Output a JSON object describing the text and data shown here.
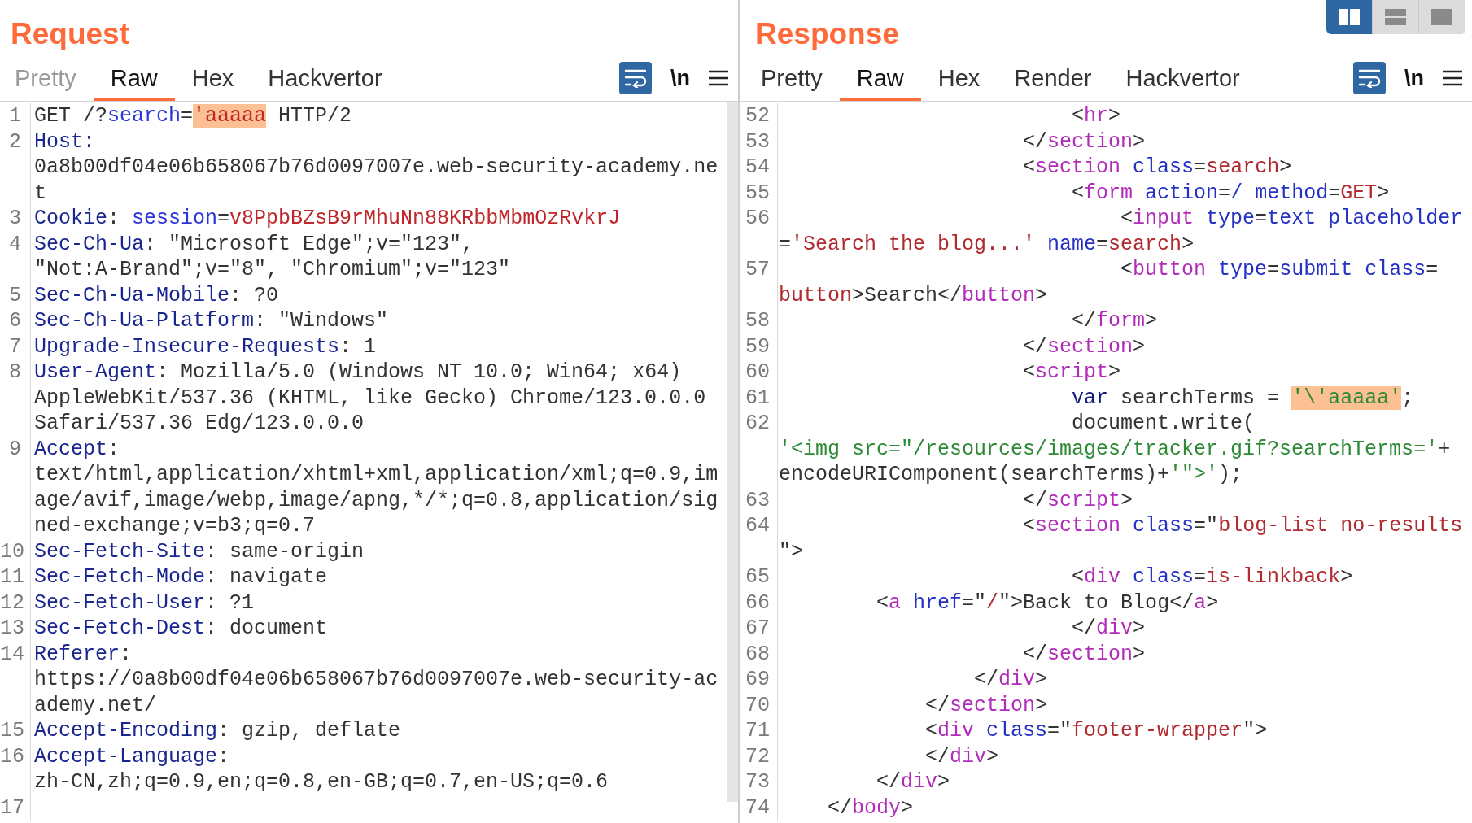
{
  "request": {
    "title": "Request",
    "tabs": [
      {
        "label": "Pretty",
        "selected": false,
        "disabled": true
      },
      {
        "label": "Raw",
        "selected": true,
        "disabled": false
      },
      {
        "label": "Hex",
        "selected": false,
        "disabled": false
      },
      {
        "label": "Hackvertor",
        "selected": false,
        "disabled": false
      }
    ],
    "toolbar": {
      "wrap": {
        "on": true
      },
      "newline": {
        "label": "\\n",
        "on": false
      }
    },
    "lines": [
      {
        "number": "1",
        "rows": [
          {
            "segments": [
              {
                "kind": "plain",
                "text": "GET /?"
              },
              {
                "kind": "param",
                "text": "search"
              },
              {
                "kind": "plain",
                "text": "="
              },
              {
                "kind": "marked-value",
                "text": "'aaaaa"
              },
              {
                "kind": "plain",
                "text": " HTTP/2"
              }
            ]
          }
        ]
      },
      {
        "number": "2",
        "rows": [
          {
            "segments": [
              {
                "kind": "header",
                "text": "Host:"
              }
            ]
          },
          {
            "segments": [
              {
                "kind": "plain",
                "text": "0a8b00df04e06b658067b76d0097007e.web-security-academy.ne"
              }
            ]
          },
          {
            "segments": [
              {
                "kind": "plain",
                "text": "t"
              }
            ]
          }
        ]
      },
      {
        "number": "3",
        "rows": [
          {
            "segments": [
              {
                "kind": "header",
                "text": "Cookie"
              },
              {
                "kind": "plain",
                "text": ": "
              },
              {
                "kind": "param",
                "text": "session"
              },
              {
                "kind": "plain",
                "text": "="
              },
              {
                "kind": "value",
                "text": "v8PpbBZsB9rMhuNn88KRbbMbmOzRvkrJ"
              }
            ]
          }
        ]
      },
      {
        "number": "4",
        "rows": [
          {
            "segments": [
              {
                "kind": "header",
                "text": "Sec-Ch-Ua"
              },
              {
                "kind": "plain",
                "text": ": \"Microsoft Edge\";v=\"123\","
              }
            ]
          },
          {
            "segments": [
              {
                "kind": "plain",
                "text": "\"Not:A-Brand\";v=\"8\", \"Chromium\";v=\"123\""
              }
            ]
          }
        ]
      },
      {
        "number": "5",
        "rows": [
          {
            "segments": [
              {
                "kind": "header",
                "text": "Sec-Ch-Ua-Mobile"
              },
              {
                "kind": "plain",
                "text": ": ?0"
              }
            ]
          }
        ]
      },
      {
        "number": "6",
        "rows": [
          {
            "segments": [
              {
                "kind": "header",
                "text": "Sec-Ch-Ua-Platform"
              },
              {
                "kind": "plain",
                "text": ": \"Windows\""
              }
            ]
          }
        ]
      },
      {
        "number": "7",
        "rows": [
          {
            "segments": [
              {
                "kind": "header",
                "text": "Upgrade-Insecure-Requests"
              },
              {
                "kind": "plain",
                "text": ": 1"
              }
            ]
          }
        ]
      },
      {
        "number": "8",
        "rows": [
          {
            "segments": [
              {
                "kind": "header",
                "text": "User-Agent"
              },
              {
                "kind": "plain",
                "text": ": Mozilla/5.0 (Windows NT 10.0; Win64; x64)"
              }
            ]
          },
          {
            "segments": [
              {
                "kind": "plain",
                "text": "AppleWebKit/537.36 (KHTML, like Gecko) Chrome/123.0.0.0"
              }
            ]
          },
          {
            "segments": [
              {
                "kind": "plain",
                "text": "Safari/537.36 Edg/123.0.0.0"
              }
            ]
          }
        ]
      },
      {
        "number": "9",
        "rows": [
          {
            "segments": [
              {
                "kind": "header",
                "text": "Accept"
              },
              {
                "kind": "plain",
                "text": ":"
              }
            ]
          },
          {
            "segments": [
              {
                "kind": "plain",
                "text": "text/html,application/xhtml+xml,application/xml;q=0.9,im"
              }
            ]
          },
          {
            "segments": [
              {
                "kind": "plain",
                "text": "age/avif,image/webp,image/apng,*/*;q=0.8,application/sig"
              }
            ]
          },
          {
            "segments": [
              {
                "kind": "plain",
                "text": "ned-exchange;v=b3;q=0.7"
              }
            ]
          }
        ]
      },
      {
        "number": "10",
        "rows": [
          {
            "segments": [
              {
                "kind": "header",
                "text": "Sec-Fetch-Site"
              },
              {
                "kind": "plain",
                "text": ": same-origin"
              }
            ]
          }
        ]
      },
      {
        "number": "11",
        "rows": [
          {
            "segments": [
              {
                "kind": "header",
                "text": "Sec-Fetch-Mode"
              },
              {
                "kind": "plain",
                "text": ": navigate"
              }
            ]
          }
        ]
      },
      {
        "number": "12",
        "rows": [
          {
            "segments": [
              {
                "kind": "header",
                "text": "Sec-Fetch-User"
              },
              {
                "kind": "plain",
                "text": ": ?1"
              }
            ]
          }
        ]
      },
      {
        "number": "13",
        "rows": [
          {
            "segments": [
              {
                "kind": "header",
                "text": "Sec-Fetch-Dest"
              },
              {
                "kind": "plain",
                "text": ": document"
              }
            ]
          }
        ]
      },
      {
        "number": "14",
        "rows": [
          {
            "segments": [
              {
                "kind": "header",
                "text": "Referer"
              },
              {
                "kind": "plain",
                "text": ":"
              }
            ]
          },
          {
            "segments": [
              {
                "kind": "plain",
                "text": "https://0a8b00df04e06b658067b76d0097007e.web-security-ac"
              }
            ]
          },
          {
            "segments": [
              {
                "kind": "plain",
                "text": "ademy.net/"
              }
            ]
          }
        ]
      },
      {
        "number": "15",
        "rows": [
          {
            "segments": [
              {
                "kind": "header",
                "text": "Accept-Encoding"
              },
              {
                "kind": "plain",
                "text": ": gzip, deflate"
              }
            ]
          }
        ]
      },
      {
        "number": "16",
        "rows": [
          {
            "segments": [
              {
                "kind": "header",
                "text": "Accept-Language"
              },
              {
                "kind": "plain",
                "text": ":"
              }
            ]
          },
          {
            "segments": [
              {
                "kind": "plain",
                "text": "zh-CN,zh;q=0.9,en;q=0.8,en-GB;q=0.7,en-US;q=0.6"
              }
            ]
          }
        ]
      },
      {
        "number": "17"
      }
    ]
  },
  "response": {
    "title": "Response",
    "layout_toggle": [
      {
        "kind": "columns",
        "selected": true
      },
      {
        "kind": "rows",
        "selected": false
      },
      {
        "kind": "single",
        "selected": false
      }
    ],
    "tabs": [
      {
        "label": "Pretty",
        "selected": false,
        "disabled": false
      },
      {
        "label": "Raw",
        "selected": true,
        "disabled": false
      },
      {
        "label": "Hex",
        "selected": false,
        "disabled": false
      },
      {
        "label": "Render",
        "selected": false,
        "disabled": false
      },
      {
        "label": "Hackvertor",
        "selected": false,
        "disabled": false
      }
    ],
    "toolbar": {
      "wrap": {
        "on": true
      },
      "newline": {
        "label": "\\n",
        "on": false
      }
    },
    "lines": [
      {
        "number": "52",
        "rows": [
          {
            "segments": [
              {
                "kind": "plain",
                "text": "                        <"
              },
              {
                "kind": "tag",
                "text": "hr"
              },
              {
                "kind": "plain",
                "text": ">"
              }
            ]
          }
        ]
      },
      {
        "number": "53",
        "rows": [
          {
            "segments": [
              {
                "kind": "plain",
                "text": "                    </"
              },
              {
                "kind": "tag",
                "text": "section"
              },
              {
                "kind": "plain",
                "text": ">"
              }
            ]
          }
        ]
      },
      {
        "number": "54",
        "rows": [
          {
            "segments": [
              {
                "kind": "plain",
                "text": "                    <"
              },
              {
                "kind": "tag",
                "text": "section"
              },
              {
                "kind": "attr",
                "text": " class"
              },
              {
                "kind": "plain",
                "text": "="
              },
              {
                "kind": "attrval",
                "text": "search"
              },
              {
                "kind": "plain",
                "text": ">"
              }
            ]
          }
        ]
      },
      {
        "number": "55",
        "rows": [
          {
            "segments": [
              {
                "kind": "plain",
                "text": "                        <"
              },
              {
                "kind": "tag",
                "text": "form"
              },
              {
                "kind": "attr",
                "text": " action"
              },
              {
                "kind": "plain",
                "text": "="
              },
              {
                "kind": "attr",
                "text": "/ method"
              },
              {
                "kind": "plain",
                "text": "="
              },
              {
                "kind": "attrval",
                "text": "GET"
              },
              {
                "kind": "plain",
                "text": ">"
              }
            ]
          }
        ]
      },
      {
        "number": "56",
        "rows": [
          {
            "segments": [
              {
                "kind": "plain",
                "text": "                            <"
              },
              {
                "kind": "tag",
                "text": "input"
              },
              {
                "kind": "attr",
                "text": " type"
              },
              {
                "kind": "plain",
                "text": "="
              },
              {
                "kind": "attr",
                "text": "text placeholder"
              }
            ]
          },
          {
            "segments": [
              {
                "kind": "plain",
                "text": "="
              },
              {
                "kind": "attrval",
                "text": "'Search the blog...'"
              },
              {
                "kind": "attr",
                "text": " name"
              },
              {
                "kind": "plain",
                "text": "="
              },
              {
                "kind": "attrval",
                "text": "search"
              },
              {
                "kind": "plain",
                "text": ">"
              }
            ]
          }
        ]
      },
      {
        "number": "57",
        "rows": [
          {
            "segments": [
              {
                "kind": "plain",
                "text": "                            <"
              },
              {
                "kind": "tag",
                "text": "button"
              },
              {
                "kind": "attr",
                "text": " type"
              },
              {
                "kind": "plain",
                "text": "="
              },
              {
                "kind": "attr",
                "text": "submit class"
              },
              {
                "kind": "plain",
                "text": "="
              }
            ]
          },
          {
            "segments": [
              {
                "kind": "attrval",
                "text": "button"
              },
              {
                "kind": "plain",
                "text": ">Search</"
              },
              {
                "kind": "tag",
                "text": "button"
              },
              {
                "kind": "plain",
                "text": ">"
              }
            ]
          }
        ]
      },
      {
        "number": "58",
        "rows": [
          {
            "segments": [
              {
                "kind": "plain",
                "text": "                        </"
              },
              {
                "kind": "tag",
                "text": "form"
              },
              {
                "kind": "plain",
                "text": ">"
              }
            ]
          }
        ]
      },
      {
        "number": "59",
        "rows": [
          {
            "segments": [
              {
                "kind": "plain",
                "text": "                    </"
              },
              {
                "kind": "tag",
                "text": "section"
              },
              {
                "kind": "plain",
                "text": ">"
              }
            ]
          }
        ]
      },
      {
        "number": "60",
        "rows": [
          {
            "segments": [
              {
                "kind": "plain",
                "text": "                    <"
              },
              {
                "kind": "tag",
                "text": "script"
              },
              {
                "kind": "plain",
                "text": ">"
              }
            ]
          }
        ]
      },
      {
        "number": "61",
        "rows": [
          {
            "segments": [
              {
                "kind": "keyword",
                "text": "                        var"
              },
              {
                "kind": "plain",
                "text": " searchTerms = "
              },
              {
                "kind": "marked-string",
                "text": "'\\'aaaaa'"
              },
              {
                "kind": "plain",
                "text": ";"
              }
            ]
          }
        ]
      },
      {
        "number": "62",
        "rows": [
          {
            "segments": [
              {
                "kind": "plain",
                "text": "                        document.write("
              }
            ]
          },
          {
            "segments": [
              {
                "kind": "string",
                "text": "'<img src=\"/resources/images/tracker.gif?searchTerms='"
              },
              {
                "kind": "plain",
                "text": "+"
              }
            ]
          },
          {
            "segments": [
              {
                "kind": "plain",
                "text": "encodeURIComponent(searchTerms)+"
              },
              {
                "kind": "string",
                "text": "'\">'"
              },
              {
                "kind": "plain",
                "text": ");"
              }
            ]
          }
        ]
      },
      {
        "number": "63",
        "rows": [
          {
            "segments": [
              {
                "kind": "plain",
                "text": "                    </"
              },
              {
                "kind": "tag",
                "text": "script"
              },
              {
                "kind": "plain",
                "text": ">"
              }
            ]
          }
        ]
      },
      {
        "number": "64",
        "rows": [
          {
            "segments": [
              {
                "kind": "plain",
                "text": "                    <"
              },
              {
                "kind": "tag",
                "text": "section"
              },
              {
                "kind": "attr",
                "text": " class"
              },
              {
                "kind": "plain",
                "text": "=\""
              },
              {
                "kind": "attrval",
                "text": "blog-list no-results"
              }
            ]
          },
          {
            "segments": [
              {
                "kind": "plain",
                "text": "\">"
              }
            ]
          }
        ]
      },
      {
        "number": "65",
        "rows": [
          {
            "segments": [
              {
                "kind": "plain",
                "text": "                        <"
              },
              {
                "kind": "tag",
                "text": "div"
              },
              {
                "kind": "attr",
                "text": " class"
              },
              {
                "kind": "plain",
                "text": "="
              },
              {
                "kind": "attrval",
                "text": "is-linkback"
              },
              {
                "kind": "plain",
                "text": ">"
              }
            ]
          }
        ]
      },
      {
        "number": "66",
        "rows": [
          {
            "segments": [
              {
                "kind": "plain",
                "text": "        <"
              },
              {
                "kind": "tag",
                "text": "a"
              },
              {
                "kind": "attr",
                "text": " href"
              },
              {
                "kind": "plain",
                "text": "=\""
              },
              {
                "kind": "attrval",
                "text": "/"
              },
              {
                "kind": "plain",
                "text": "\">Back to Blog</"
              },
              {
                "kind": "tag",
                "text": "a"
              },
              {
                "kind": "plain",
                "text": ">"
              }
            ]
          }
        ]
      },
      {
        "number": "67",
        "rows": [
          {
            "segments": [
              {
                "kind": "plain",
                "text": "                        </"
              },
              {
                "kind": "tag",
                "text": "div"
              },
              {
                "kind": "plain",
                "text": ">"
              }
            ]
          }
        ]
      },
      {
        "number": "68",
        "rows": [
          {
            "segments": [
              {
                "kind": "plain",
                "text": "                    </"
              },
              {
                "kind": "tag",
                "text": "section"
              },
              {
                "kind": "plain",
                "text": ">"
              }
            ]
          }
        ]
      },
      {
        "number": "69",
        "rows": [
          {
            "segments": [
              {
                "kind": "plain",
                "text": "                </"
              },
              {
                "kind": "tag",
                "text": "div"
              },
              {
                "kind": "plain",
                "text": ">"
              }
            ]
          }
        ]
      },
      {
        "number": "70",
        "rows": [
          {
            "segments": [
              {
                "kind": "plain",
                "text": "            </"
              },
              {
                "kind": "tag",
                "text": "section"
              },
              {
                "kind": "plain",
                "text": ">"
              }
            ]
          }
        ]
      },
      {
        "number": "71",
        "rows": [
          {
            "segments": [
              {
                "kind": "plain",
                "text": "            <"
              },
              {
                "kind": "tag",
                "text": "div"
              },
              {
                "kind": "attr",
                "text": " class"
              },
              {
                "kind": "plain",
                "text": "=\""
              },
              {
                "kind": "attrval",
                "text": "footer-wrapper"
              },
              {
                "kind": "plain",
                "text": "\">"
              }
            ]
          }
        ]
      },
      {
        "number": "72",
        "rows": [
          {
            "segments": [
              {
                "kind": "plain",
                "text": "            </"
              },
              {
                "kind": "tag",
                "text": "div"
              },
              {
                "kind": "plain",
                "text": ">"
              }
            ]
          }
        ]
      },
      {
        "number": "73",
        "rows": [
          {
            "segments": [
              {
                "kind": "plain",
                "text": "        </"
              },
              {
                "kind": "tag",
                "text": "div"
              },
              {
                "kind": "plain",
                "text": ">"
              }
            ]
          }
        ]
      },
      {
        "number": "74",
        "rows": [
          {
            "segments": [
              {
                "kind": "plain",
                "text": "    </"
              },
              {
                "kind": "tag",
                "text": "body"
              },
              {
                "kind": "plain",
                "text": ">"
              }
            ]
          }
        ]
      }
    ]
  }
}
